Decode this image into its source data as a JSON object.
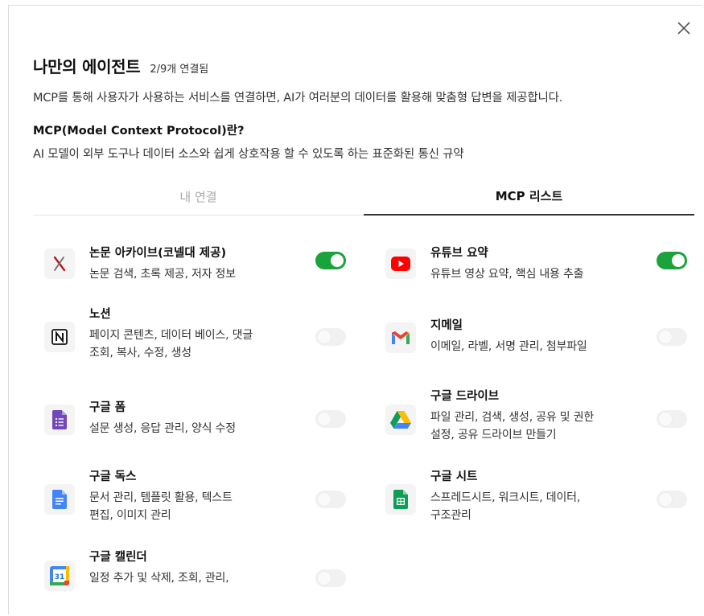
{
  "modal": {
    "title": "나만의 에이전트",
    "connected_count": "2/9개 연결됨",
    "description": "MCP를 통해 사용자가 사용하는 서비스를 연결하면, AI가 여러분의 데이터를 활용해 맞춤형 답변을 제공합니다.",
    "mcp_question": "MCP(Model Context Protocol)란?",
    "mcp_answer": "AI 모델이 외부 도구나 데이터 소스와 쉽게 상호작용 할 수 있도록 하는 표준화된 통신 규약"
  },
  "tabs": [
    {
      "label": "내 연결",
      "active": false
    },
    {
      "label": "MCP 리스트",
      "active": true
    }
  ],
  "services": [
    {
      "name": "논문 아카이브(코넬대 제공)",
      "desc_lines": [
        "논문 검색, 초록 제공, 저자 정보"
      ],
      "icon": "arxiv-icon",
      "enabled": true
    },
    {
      "name": "유튜브 요약",
      "desc_lines": [
        "유튜브 영상 요약, 핵심 내용 추출"
      ],
      "icon": "youtube-icon",
      "enabled": true
    },
    {
      "name": "노션",
      "desc_lines": [
        "페이지 콘텐츠, 데이터 베이스, 댓글",
        "조회, 복사, 수정, 생성"
      ],
      "icon": "notion-icon",
      "enabled": false
    },
    {
      "name": "지메일",
      "desc_lines": [
        "이메일, 라벨, 서명 관리, 첨부파일"
      ],
      "icon": "gmail-icon",
      "enabled": false
    },
    {
      "name": "구글 폼",
      "desc_lines": [
        "설문 생성, 응답 관리, 양식 수정"
      ],
      "icon": "google-forms-icon",
      "enabled": false
    },
    {
      "name": "구글 드라이브",
      "desc_lines": [
        "파일 관리, 검색, 생성, 공유 및 권한",
        "설정, 공유 드라이브 만들기"
      ],
      "icon": "google-drive-icon",
      "enabled": false
    },
    {
      "name": "구글 독스",
      "desc_lines": [
        "문서 관리, 템플릿 활용, 텍스트",
        "편집, 이미지 관리"
      ],
      "icon": "google-docs-icon",
      "enabled": false
    },
    {
      "name": "구글 시트",
      "desc_lines": [
        "스프레드시트, 워크시트, 데이터,",
        "구조관리"
      ],
      "icon": "google-sheets-icon",
      "enabled": false
    },
    {
      "name": "구글 캘린더",
      "desc_lines": [
        "일정 추가 및 삭제, 조회, 관리,"
      ],
      "icon": "google-calendar-icon",
      "enabled": false,
      "icon_text": "31"
    }
  ],
  "colors": {
    "toggle_on": "#1aa33a",
    "toggle_off": "#f1f1f1",
    "tab_active_text": "#111111",
    "tab_inactive_text": "#aaaaaa"
  }
}
